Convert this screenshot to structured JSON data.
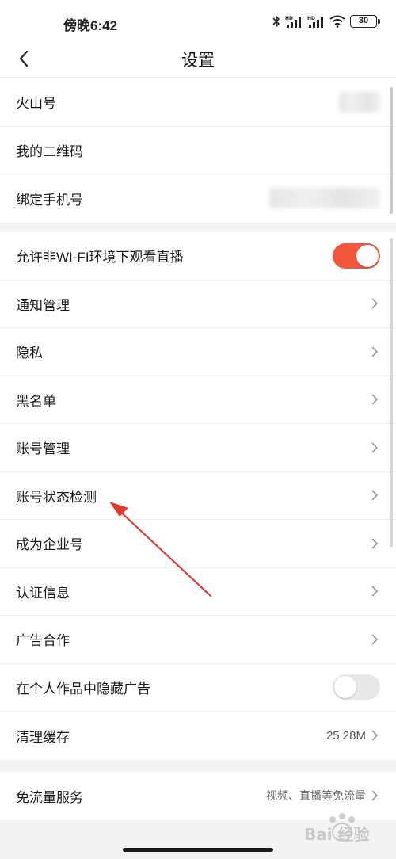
{
  "status_bar": {
    "time": "傍晚6:42",
    "battery": "30",
    "icons": [
      "bluetooth-icon",
      "hd-signal-icon",
      "hd-signal-icon",
      "wifi-icon",
      "battery-icon"
    ]
  },
  "header": {
    "title": "设置",
    "back_icon": "chevron-left-icon"
  },
  "account_section": {
    "rows": [
      {
        "label": "火山号"
      },
      {
        "label": "我的二维码"
      },
      {
        "label": "绑定手机号"
      }
    ]
  },
  "settings_section": {
    "rows": [
      {
        "label": "允许非WI-FI环境下观看直播",
        "toggle": true
      },
      {
        "label": "通知管理"
      },
      {
        "label": "隐私"
      },
      {
        "label": "黑名单"
      },
      {
        "label": "账号管理"
      },
      {
        "label": "账号状态检测"
      },
      {
        "label": "成为企业号"
      },
      {
        "label": "认证信息"
      },
      {
        "label": "广告合作"
      },
      {
        "label": "在个人作品中隐藏广告",
        "toggle": false
      },
      {
        "label": "清理缓存",
        "value": "25.28M"
      }
    ]
  },
  "traffic_section": {
    "label": "免流量服务",
    "value": "视频、直播等免流量"
  },
  "colors": {
    "toggle_on": "#f1563c",
    "toggle_off": "#e8e8e8",
    "annotation_arrow": "#e23a2e"
  },
  "watermark": {
    "text": "Bai 经验"
  }
}
